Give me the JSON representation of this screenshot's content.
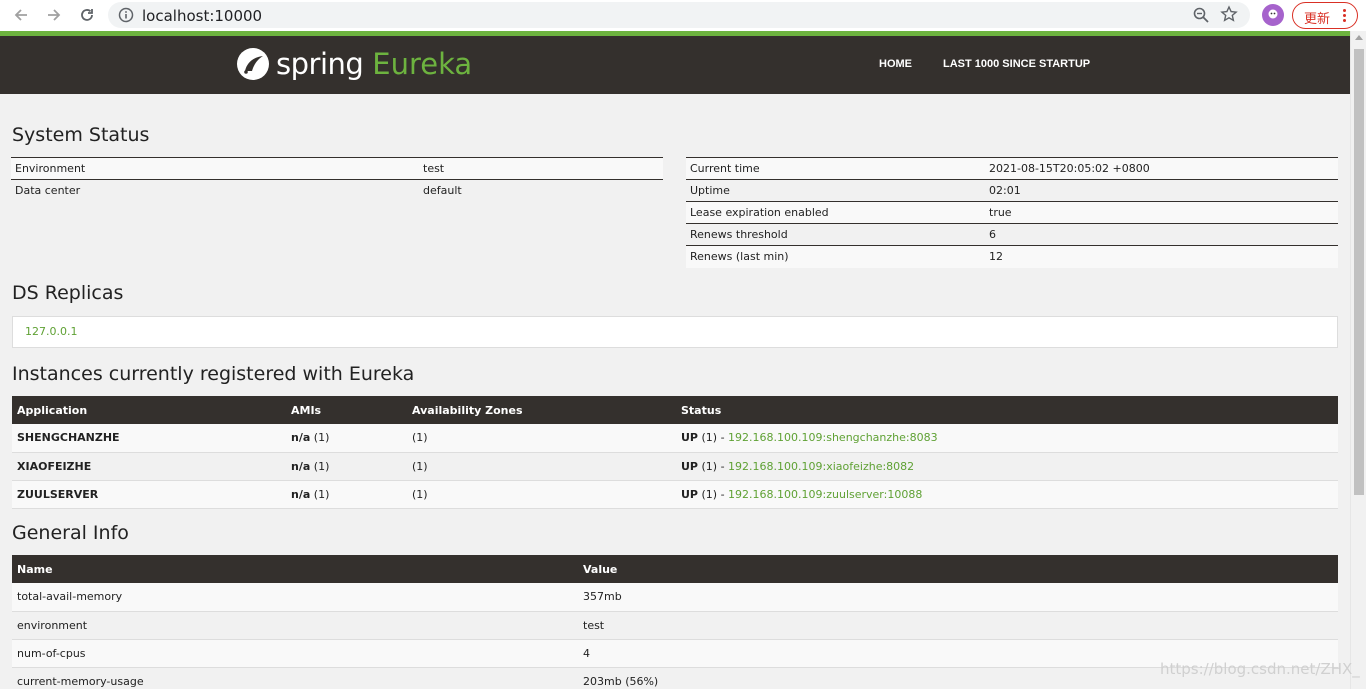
{
  "browser": {
    "url": "localhost:10000",
    "update_label": "更新"
  },
  "brand": {
    "word1": "spring",
    "word2": "Eureka",
    "accent": "#6db33f",
    "header_bg": "#34302d"
  },
  "nav": {
    "home": "HOME",
    "last1000": "LAST 1000 SINCE STARTUP"
  },
  "system_status": {
    "title": "System Status",
    "left": [
      {
        "key": "Environment",
        "value": "test"
      },
      {
        "key": "Data center",
        "value": "default"
      }
    ],
    "right": [
      {
        "key": "Current time",
        "value": "2021-08-15T20:05:02 +0800"
      },
      {
        "key": "Uptime",
        "value": "02:01"
      },
      {
        "key": "Lease expiration enabled",
        "value": "true"
      },
      {
        "key": "Renews threshold",
        "value": "6"
      },
      {
        "key": "Renews (last min)",
        "value": "12"
      }
    ]
  },
  "ds_replicas": {
    "title": "DS Replicas",
    "items": [
      "127.0.0.1"
    ]
  },
  "instances": {
    "title": "Instances currently registered with Eureka",
    "headers": [
      "Application",
      "AMIs",
      "Availability Zones",
      "Status"
    ],
    "rows": [
      {
        "application": "SHENGCHANZHE",
        "amis_bold": "n/a",
        "amis_count": " (1)",
        "zones": "(1)",
        "status_bold": "UP",
        "status_count": " (1) - ",
        "status_link": "192.168.100.109:shengchanzhe:8083"
      },
      {
        "application": "XIAOFEIZHE",
        "amis_bold": "n/a",
        "amis_count": " (1)",
        "zones": "(1)",
        "status_bold": "UP",
        "status_count": " (1) - ",
        "status_link": "192.168.100.109:xiaofeizhe:8082"
      },
      {
        "application": "ZUULSERVER",
        "amis_bold": "n/a",
        "amis_count": " (1)",
        "zones": "(1)",
        "status_bold": "UP",
        "status_count": " (1) - ",
        "status_link": "192.168.100.109:zuulserver:10088"
      }
    ]
  },
  "general_info": {
    "title": "General Info",
    "headers": [
      "Name",
      "Value"
    ],
    "rows": [
      {
        "name": "total-avail-memory",
        "value": "357mb"
      },
      {
        "name": "environment",
        "value": "test"
      },
      {
        "name": "num-of-cpus",
        "value": "4"
      },
      {
        "name": "current-memory-usage",
        "value": "203mb (56%)"
      }
    ]
  },
  "watermark": "https://blog.csdn.net/ZHX_"
}
